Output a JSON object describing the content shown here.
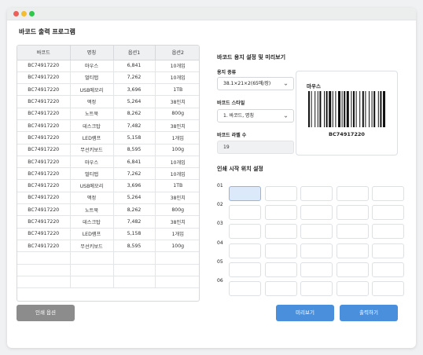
{
  "app": {
    "title": "바코드 출력 프로그램"
  },
  "table": {
    "headers": [
      "바코드",
      "명칭",
      "옵션1",
      "옵션2"
    ],
    "rows": [
      [
        "BC74917220",
        "마우스",
        "6,841",
        "10개입"
      ],
      [
        "BC74917220",
        "멀티탭",
        "7,262",
        "10개입"
      ],
      [
        "BC74917220",
        "USB메모리",
        "3,696",
        "1TB"
      ],
      [
        "BC74917220",
        "액정",
        "5,264",
        "38인치"
      ],
      [
        "BC74917220",
        "노트북",
        "8,262",
        "800g"
      ],
      [
        "BC74917220",
        "데스크탑",
        "7,482",
        "38인치"
      ],
      [
        "BC74917220",
        "LED램프",
        "5,158",
        "1개입"
      ],
      [
        "BC74917220",
        "무선키보드",
        "8,595",
        "100g"
      ],
      [
        "BC74917220",
        "마우스",
        "6,841",
        "10개입"
      ],
      [
        "BC74917220",
        "멀티탭",
        "7,262",
        "10개입"
      ],
      [
        "BC74917220",
        "USB메모리",
        "3,696",
        "1TB"
      ],
      [
        "BC74917220",
        "액정",
        "5,264",
        "38인치"
      ],
      [
        "BC74917220",
        "노트북",
        "8,262",
        "800g"
      ],
      [
        "BC74917220",
        "데스크탑",
        "7,482",
        "38인치"
      ],
      [
        "BC74917220",
        "LED램프",
        "5,158",
        "1개입"
      ],
      [
        "BC74917220",
        "무선키보드",
        "8,595",
        "100g"
      ],
      [
        "",
        "",
        "",
        ""
      ],
      [
        "",
        "",
        "",
        ""
      ],
      [
        "",
        "",
        "",
        ""
      ]
    ]
  },
  "settings": {
    "title": "바코드 용지 설정 및 미리보기",
    "paper_label": "용지 종류",
    "paper_value": "38.1×21×2(65매/장)",
    "style_label": "바코드 스타일",
    "style_value": "1. 바코드, 명칭",
    "count_label": "바코드 라벨 수",
    "count_value": "19"
  },
  "preview": {
    "name": "마우스",
    "code": "BC74917220"
  },
  "position": {
    "title": "인쇄 시작 위치 설정",
    "row_labels": [
      "01",
      "02",
      "03",
      "04",
      "05",
      "06"
    ],
    "columns": 5,
    "selected": [
      0,
      0
    ]
  },
  "buttons": {
    "print_options": "인쇄 옵션",
    "preview": "미리보기",
    "print": "출력하기"
  },
  "colors": {
    "accent": "#4a8fdc",
    "selected_cell": "#dbe9fb",
    "secondary_button": "#8c8c8c"
  },
  "icons": {
    "select_chevron": "chevron-down-icon"
  }
}
